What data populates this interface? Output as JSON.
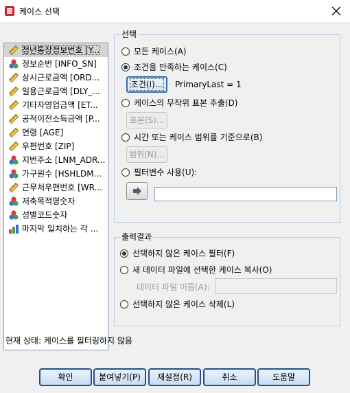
{
  "window": {
    "title": "케이스 선택"
  },
  "variables": [
    {
      "label": "청년통장정보번호 [Y...",
      "icon": "scale-ruler-icon",
      "selected": true
    },
    {
      "label": "정보순번 [INFO_SN]",
      "icon": "nominal-icon"
    },
    {
      "label": "상시근로금액 [ORD...",
      "icon": "scale-ruler-icon"
    },
    {
      "label": "일용근로금액 [DLY_...",
      "icon": "scale-ruler-icon"
    },
    {
      "label": "기타자영업금액 [ET...",
      "icon": "scale-ruler-icon"
    },
    {
      "label": "공적이전소득금액 [P...",
      "icon": "scale-ruler-icon"
    },
    {
      "label": "연령 [AGE]",
      "icon": "scale-ruler-icon"
    },
    {
      "label": "우편번호 [ZIP]",
      "icon": "scale-ruler-icon"
    },
    {
      "label": "지번주소 [LNM_ADR...",
      "icon": "nominal-icon"
    },
    {
      "label": "가구원수 [HSHLDM...",
      "icon": "nominal-icon"
    },
    {
      "label": "근무처우편번호 [WR...",
      "icon": "scale-ruler-icon"
    },
    {
      "label": "저축목적명숫자",
      "icon": "nominal-icon"
    },
    {
      "label": "성별코드숫자",
      "icon": "nominal-icon"
    },
    {
      "label": "마지막 일치하는 각 ...",
      "icon": "bar-chart-icon"
    }
  ],
  "select_group": {
    "legend": "선택",
    "options": {
      "all": "모든 케이스(A)",
      "if_condition": "조건을 만족하는 케이스(C)",
      "random": "케이스의 무작위 표본 추출(D)",
      "range": "시간 또는 케이스 범위를 기준으로(B)",
      "filter_var": "필터변수 사용(U):"
    },
    "selected": "if_condition",
    "if_button": "조건(I)...",
    "condition_text": "PrimaryLast = 1",
    "sample_button": "표본(S)...",
    "range_button": "범위(N)...",
    "arrow_icon": "arrow-right-icon",
    "filter_value": ""
  },
  "output_group": {
    "legend": "출력결과",
    "options": {
      "filter": "선택하지 않은 케이스 필터(F)",
      "copy": "새 데이터 파일에 선택한 케이스 복사(O)",
      "delete": "선택하지 않은 케이스 삭제(L)"
    },
    "selected": "filter",
    "dataset_label": "데이터 파일 이름(A):",
    "dataset_value": ""
  },
  "status_text": "현재 상태: 케이스를 필터링하지 않음",
  "buttons": {
    "ok": "확인",
    "paste": "붙여넣기(P)",
    "reset": "재설정(R)",
    "cancel": "취소",
    "help": "도움말"
  },
  "colors": {
    "accent": "#2d6bb5",
    "dialog_bg": "#f0f0f0"
  }
}
